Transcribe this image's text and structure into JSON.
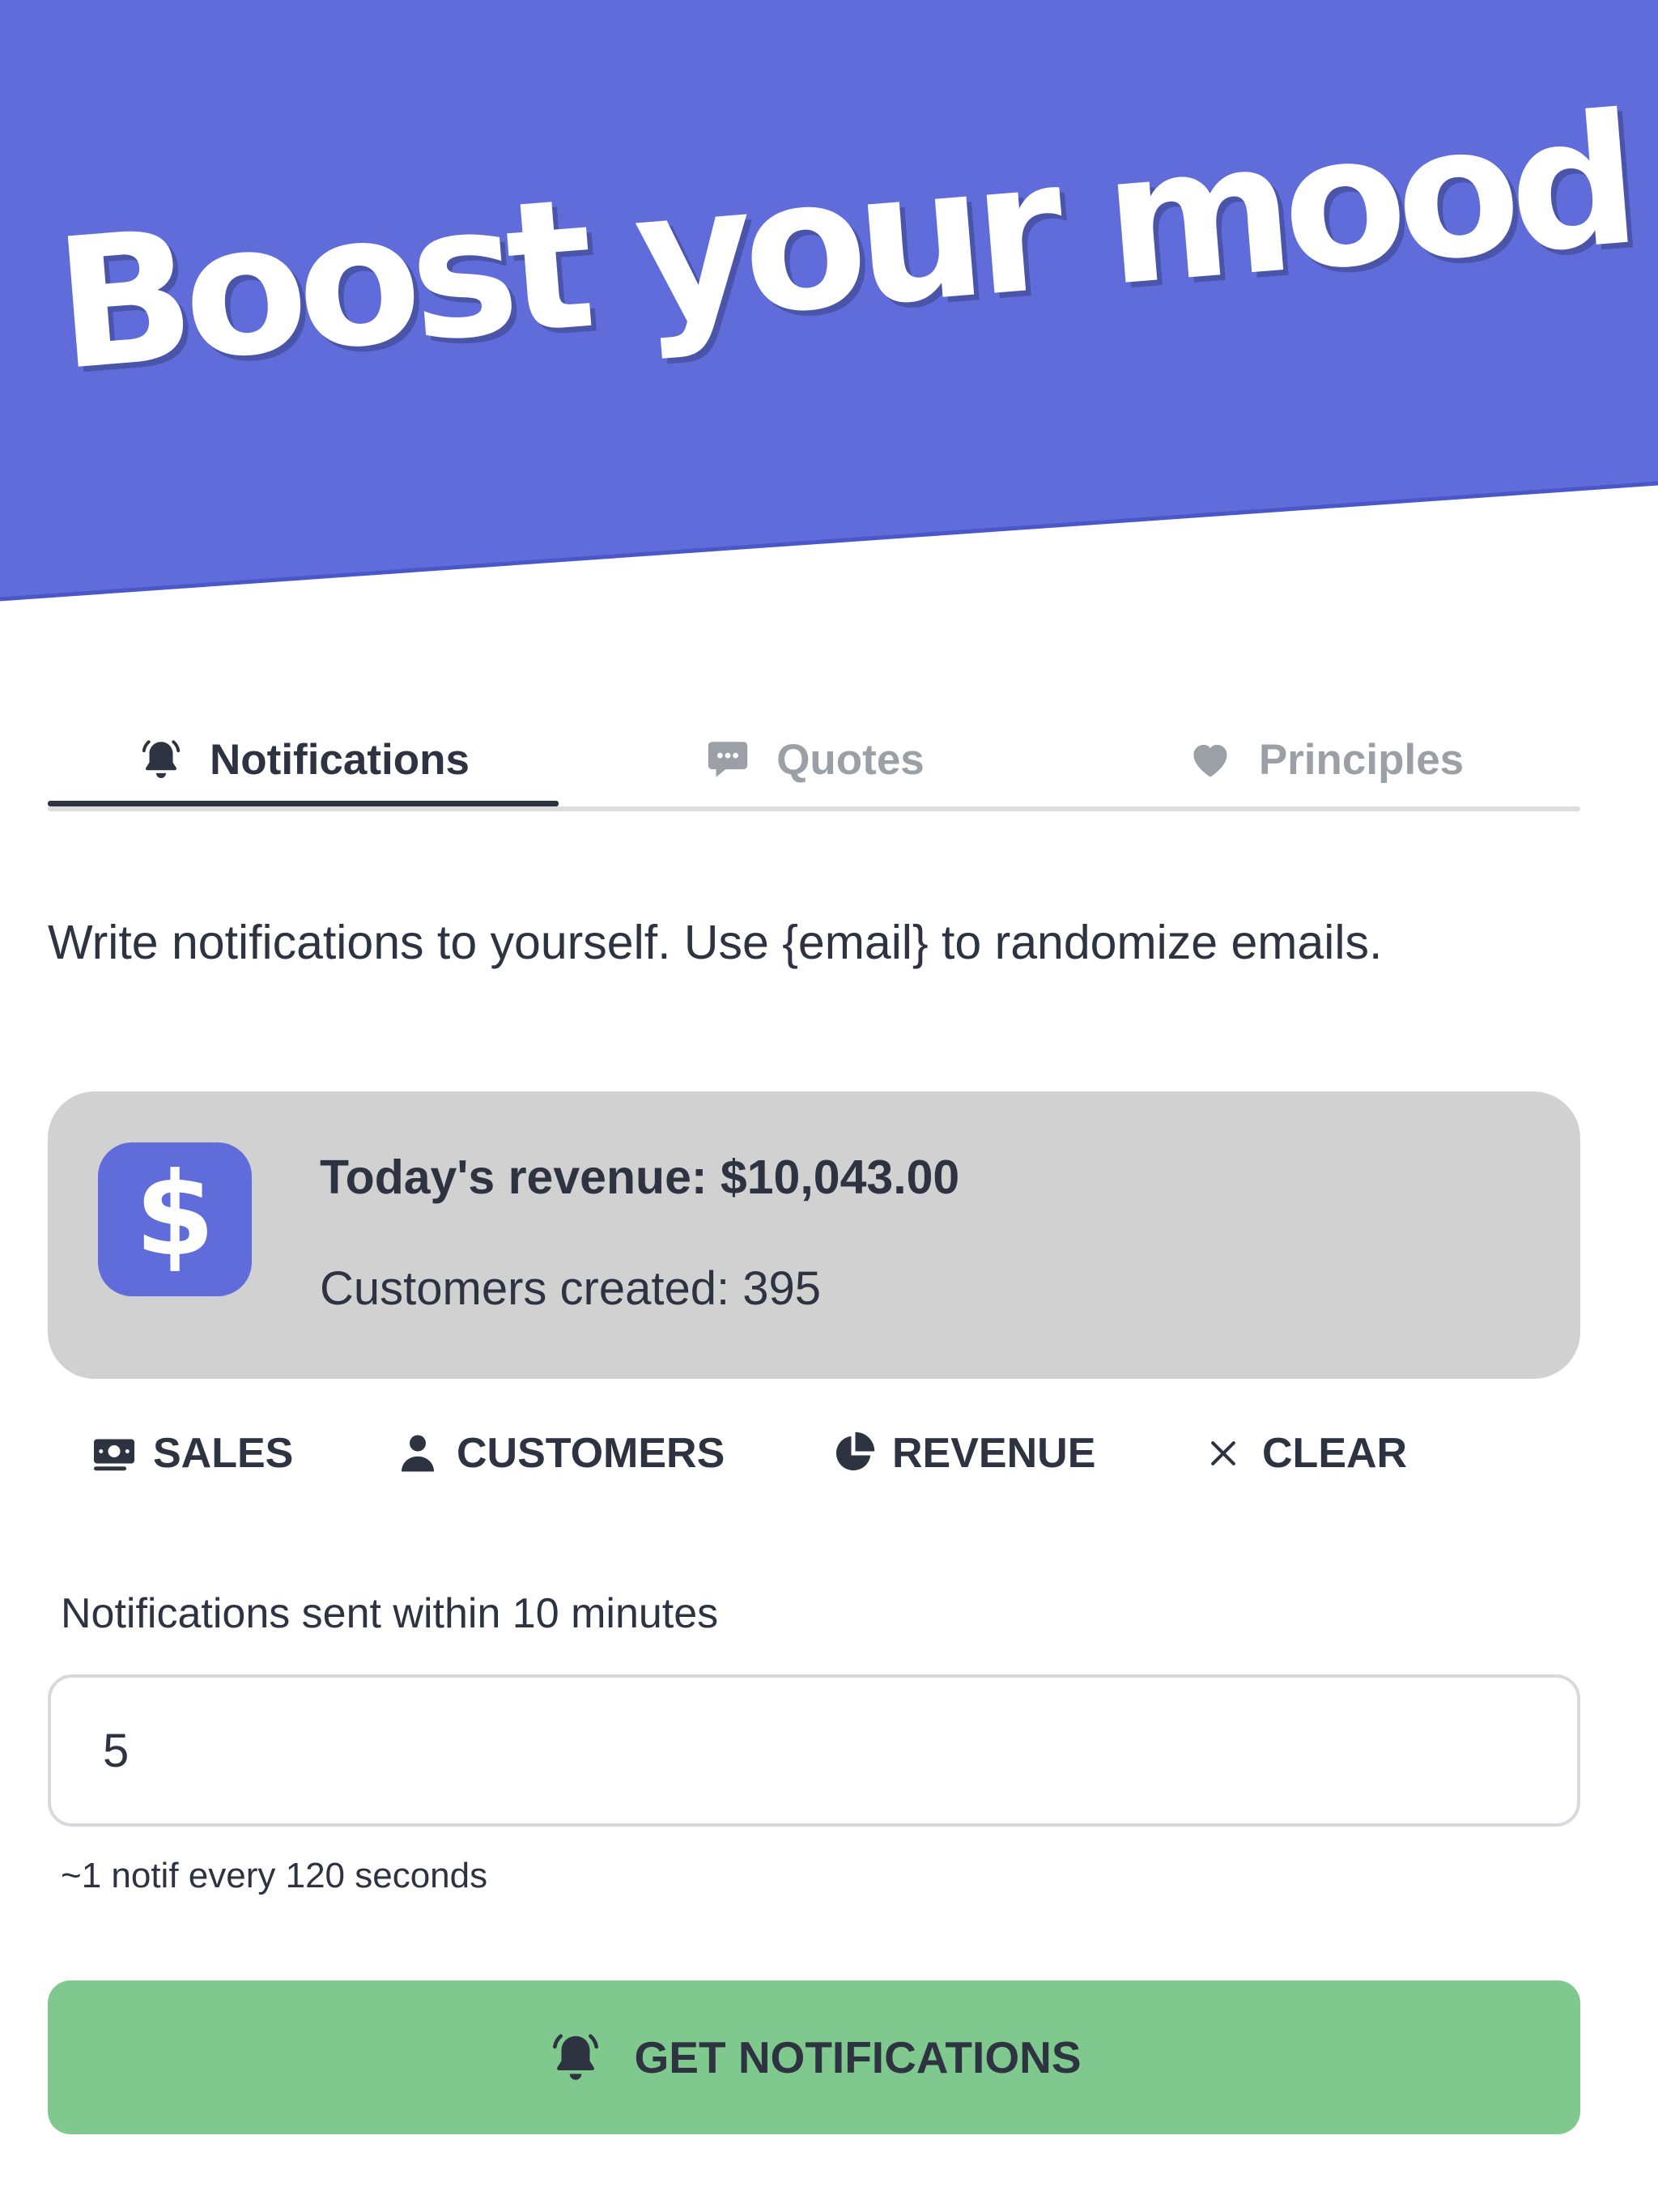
{
  "hero": {
    "title": "Boost your mood"
  },
  "tabs": [
    {
      "label": "Notifications",
      "icon": "bell-icon",
      "active": true
    },
    {
      "label": "Quotes",
      "icon": "chat-bubble-icon",
      "active": false
    },
    {
      "label": "Principles",
      "icon": "heart-icon",
      "active": false
    }
  ],
  "description": "Write notifications to yourself. Use {email} to randomize emails.",
  "notification_card": {
    "icon": "dollar-icon",
    "icon_text": "$",
    "title": "Today's revenue: $10,043.00",
    "subtitle": "Customers created: 395"
  },
  "actions": [
    {
      "label": "SALES",
      "icon": "money-icon"
    },
    {
      "label": "CUSTOMERS",
      "icon": "user-icon"
    },
    {
      "label": "REVENUE",
      "icon": "pie-chart-icon"
    },
    {
      "label": "CLEAR",
      "icon": "close-icon"
    }
  ],
  "form": {
    "label": "Notifications sent within 10 minutes",
    "value": "5",
    "hint": "~1 notif every 120 seconds"
  },
  "cta": {
    "label": "GET NOTIFICATIONS",
    "icon": "bell-icon"
  },
  "colors": {
    "accent": "#5f6cd9",
    "card_bg": "#d1d1d1",
    "cta_bg": "#80c98e",
    "text": "#2d3340",
    "muted": "#9aa0a6"
  }
}
